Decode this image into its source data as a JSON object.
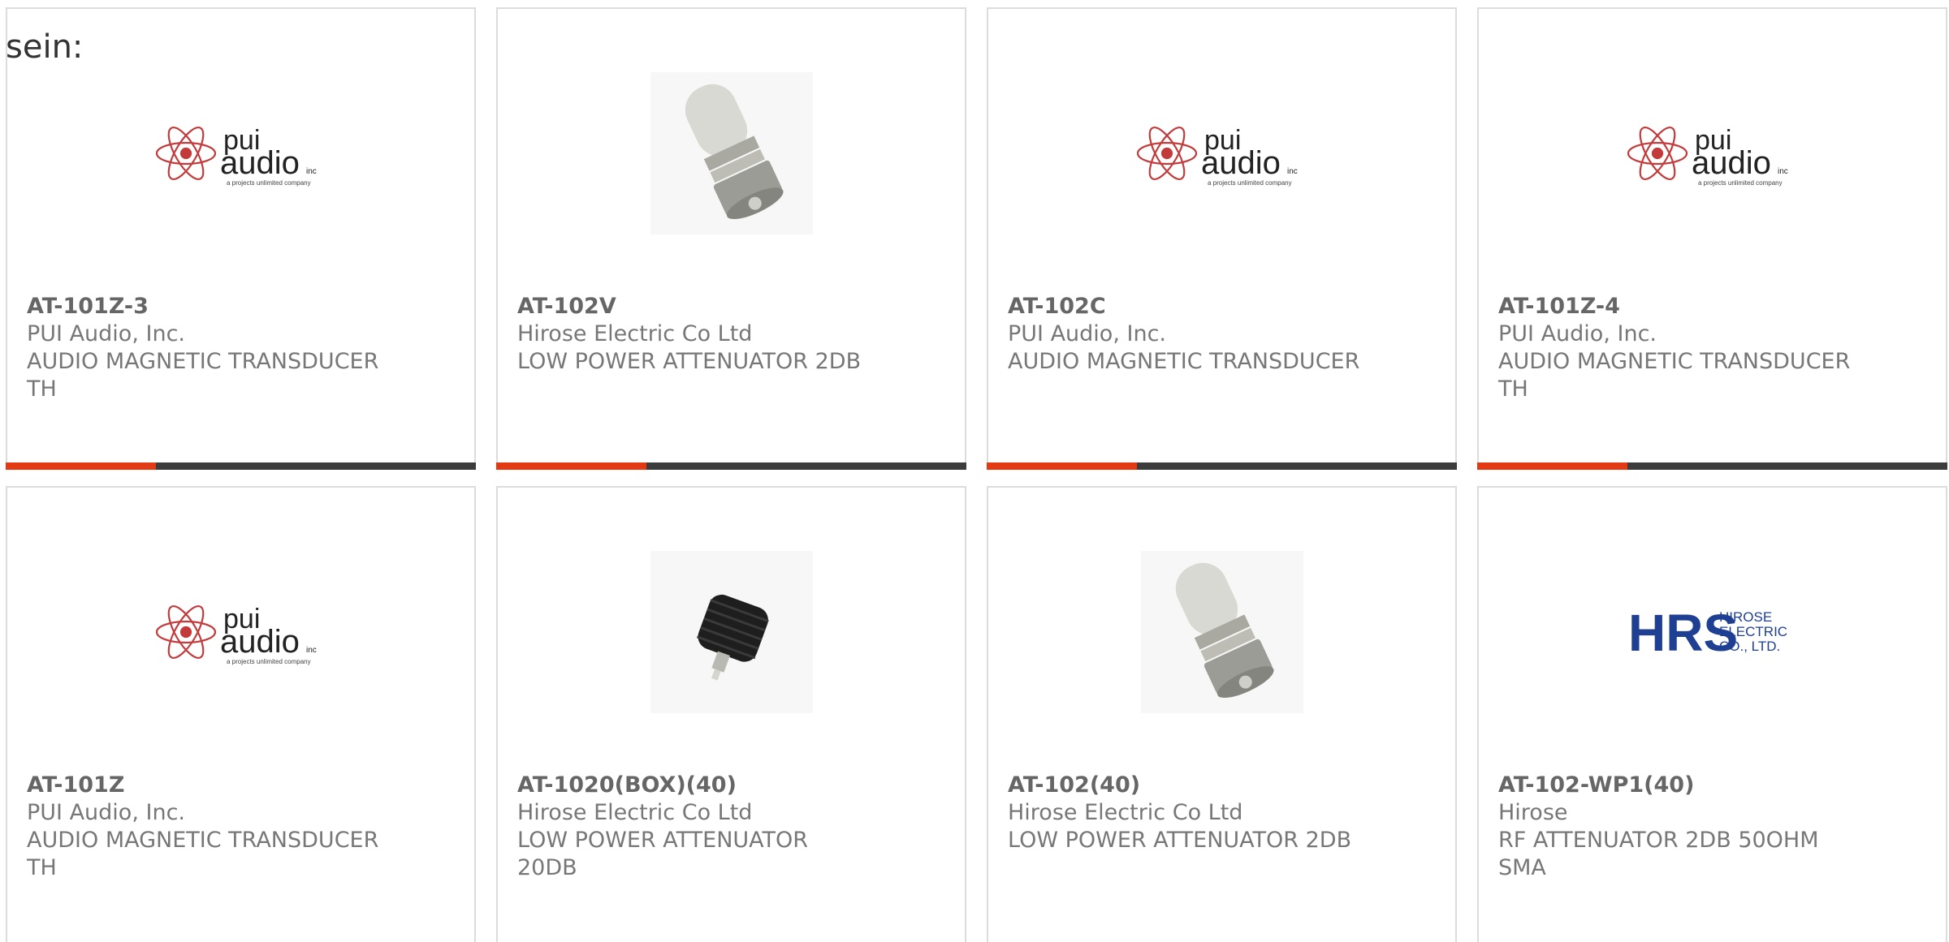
{
  "intro_text": "sein:",
  "colors": {
    "accent": "#e23a12",
    "bar": "#3c3c3c",
    "text": "#777777"
  },
  "products": [
    {
      "part": "AT-101Z-3",
      "maker": "PUI Audio, Inc.",
      "desc": "AUDIO MAGNETIC TRANSDUCER TH",
      "image": "pui-audio-logo"
    },
    {
      "part": "AT-102V",
      "maker": "Hirose Electric Co Ltd",
      "desc": "LOW POWER ATTENUATOR 2DB",
      "image": "attenuator-photo"
    },
    {
      "part": "AT-102C",
      "maker": "PUI Audio, Inc.",
      "desc": "AUDIO MAGNETIC TRANSDUCER",
      "image": "pui-audio-logo"
    },
    {
      "part": "AT-101Z-4",
      "maker": "PUI Audio, Inc.",
      "desc": "AUDIO MAGNETIC TRANSDUCER TH",
      "image": "pui-audio-logo"
    },
    {
      "part": "AT-101Z",
      "maker": "PUI Audio, Inc.",
      "desc": "AUDIO MAGNETIC TRANSDUCER TH",
      "image": "pui-audio-logo"
    },
    {
      "part": "AT-1020(BOX)(40)",
      "maker": "Hirose Electric Co Ltd",
      "desc": "LOW POWER ATTENUATOR 20DB",
      "image": "heatsink-attenuator-photo"
    },
    {
      "part": "AT-102(40)",
      "maker": "Hirose Electric Co Ltd",
      "desc": "LOW POWER ATTENUATOR 2DB",
      "image": "attenuator-photo"
    },
    {
      "part": "AT-102-WP1(40)",
      "maker": "Hirose",
      "desc": "RF ATTENUATOR 2DB 50OHM SMA",
      "image": "hrs-logo"
    }
  ],
  "logos": {
    "pui_line1": "pui",
    "pui_line2": "audio",
    "pui_inc": "inc",
    "pui_tagline": "a projects unlimited company",
    "hrs_mark": "HRS",
    "hrs_l1": "HIROSE",
    "hrs_l2": "ELECTRIC",
    "hrs_l3": "CO., LTD."
  }
}
